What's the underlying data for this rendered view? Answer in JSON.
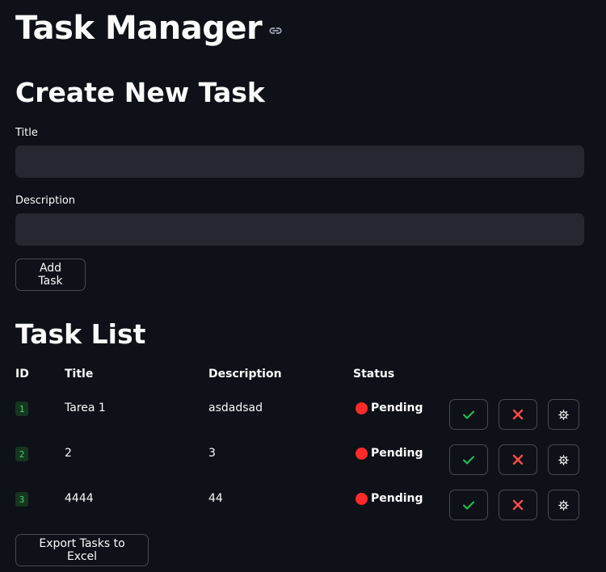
{
  "app": {
    "title": "Task Manager"
  },
  "create_section": {
    "heading": "Create New Task",
    "title_label": "Title",
    "title_value": "",
    "description_label": "Description",
    "description_value": "",
    "add_button_label": "Add Task"
  },
  "task_list": {
    "heading": "Task List",
    "columns": [
      "ID",
      "Title",
      "Description",
      "Status"
    ],
    "rows": [
      {
        "id": "1",
        "title": "Tarea 1",
        "description": "asdadsad",
        "status": "Pending"
      },
      {
        "id": "2",
        "title": "2",
        "description": "3",
        "status": "Pending"
      },
      {
        "id": "3",
        "title": "4444",
        "description": "44",
        "status": "Pending"
      }
    ],
    "action_icons": [
      "check-icon",
      "close-icon",
      "gear-icon"
    ],
    "status_color": "#ff2b2b",
    "check_color": "#21c354",
    "cross_color": "#ff4b4b"
  },
  "export_button_label": "Export Tasks to Excel"
}
